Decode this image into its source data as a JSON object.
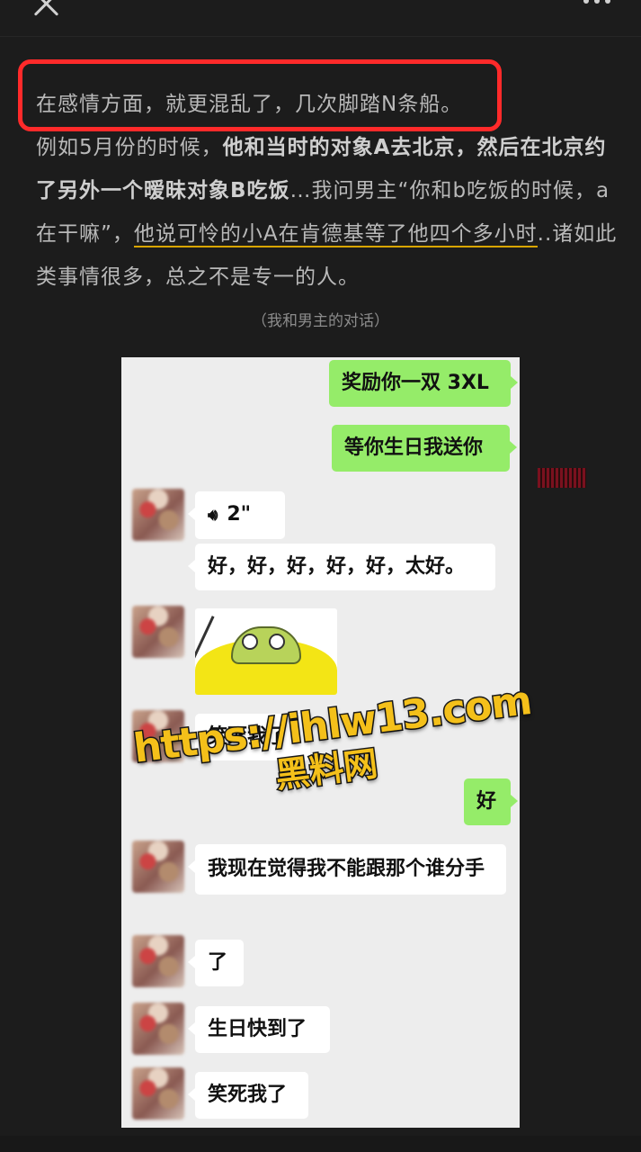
{
  "article": {
    "line1": "在感情方面，就更混乱了，几次脚踏N条船。",
    "p2_intro": "例如5月份的时候，",
    "p2_bold": "他和当时的对象A去北京，然后在北京约了另外一个暧昧对象B吃饭",
    "p2_mid": "…我问男主“你和b吃饭的时候，a在干嘛”，",
    "p2_underline": "他说可怜的小A在肯德基等了他四个多小时",
    "p2_end": "..诸如此类事情很多，总之不是专一的人。",
    "caption": "（我和男主的对话）"
  },
  "chat": {
    "msg1": "奖励你一双 3XL",
    "msg2": "等你生日我送你",
    "voice_duration": "2\"",
    "msg3": "好，好，好，好，好，太好。",
    "msg4": "笑死我了",
    "msg5": "好",
    "msg6": "我现在觉得我不能跟那个谁分手",
    "msg7": "了",
    "msg8": "生日快到了",
    "msg9": "笑死我了"
  },
  "watermark": {
    "url": "https://ihlw13.com",
    "site": "黑料网"
  },
  "icons": {
    "close": "close-icon",
    "more": "more-icon",
    "voice": "voice-icon"
  },
  "colors": {
    "highlight_border": "#ff2a2a",
    "underline": "#d9a500",
    "my_bubble": "#95ec69",
    "watermark": "#f4c01a"
  }
}
